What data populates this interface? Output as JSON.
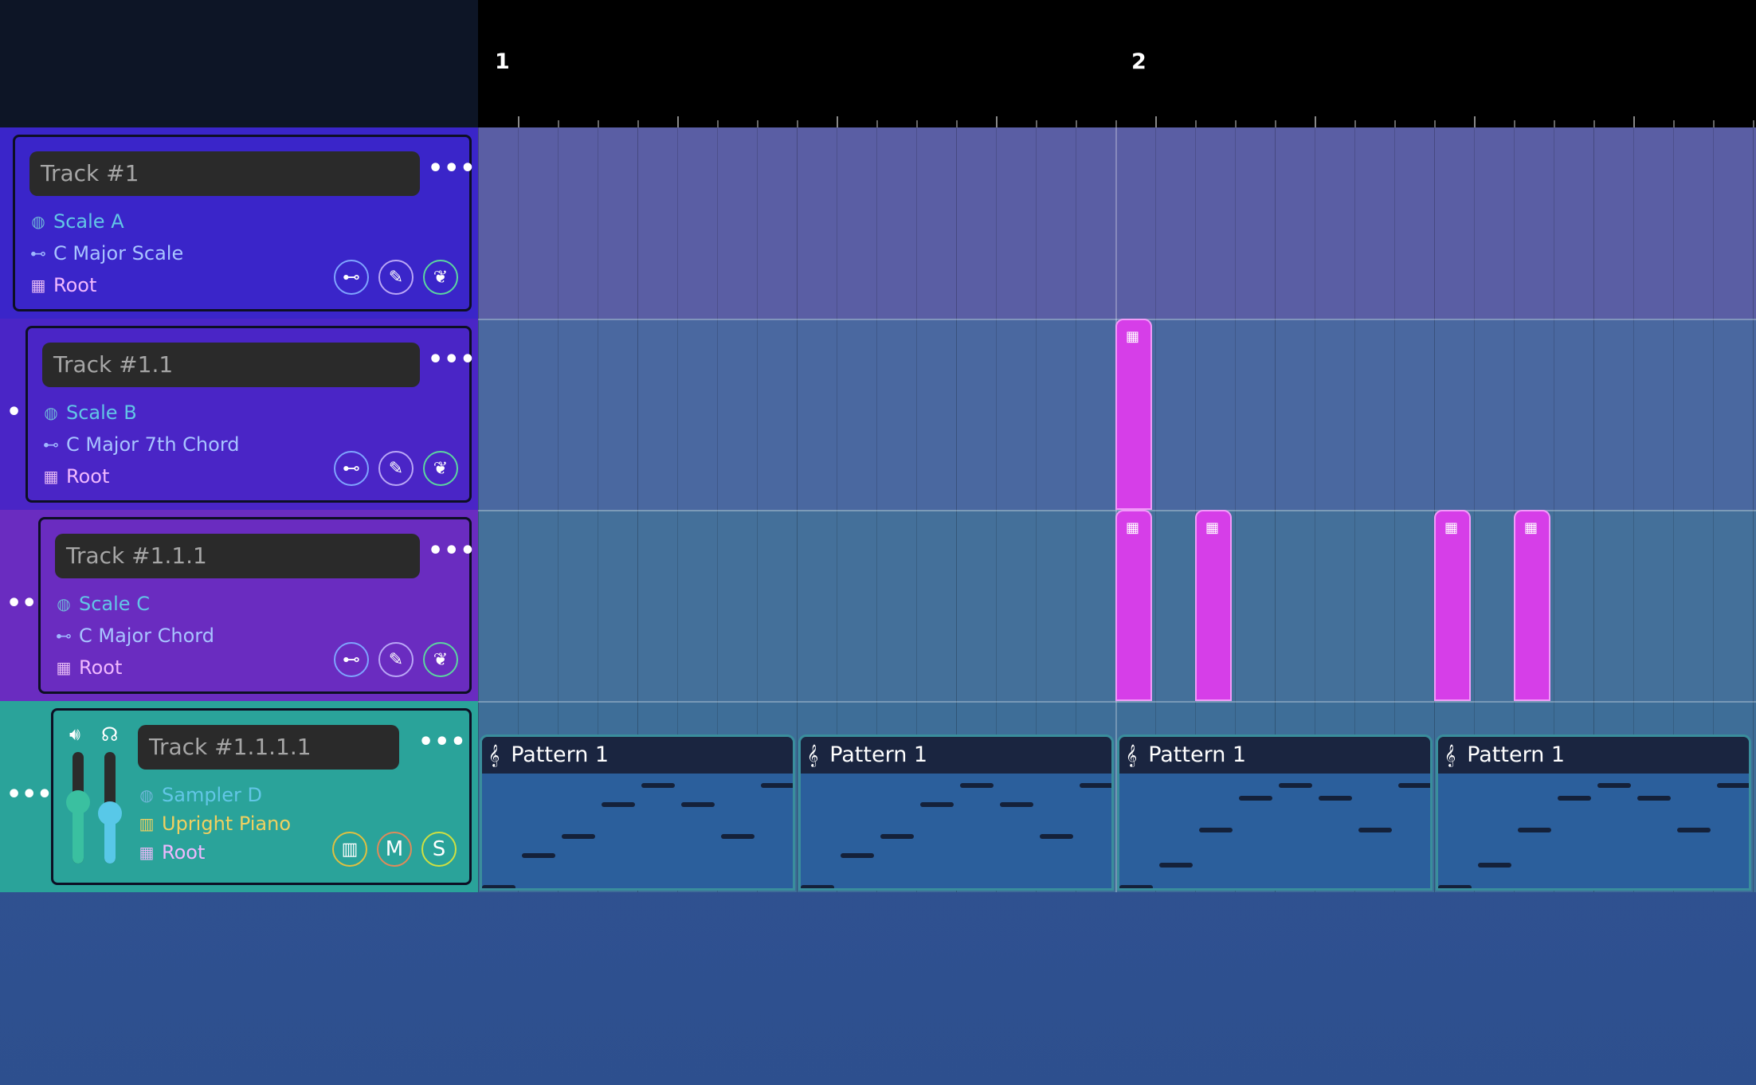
{
  "ruler": {
    "bars": [
      "1",
      "2"
    ]
  },
  "tracks": [
    {
      "name": "Track #1",
      "scale": "Scale A",
      "pattern_type": "C Major Scale",
      "pose": "Root"
    },
    {
      "name": "Track #1.1",
      "scale": "Scale B",
      "pattern_type": "C Major 7th Chord",
      "pose": "Root"
    },
    {
      "name": "Track #1.1.1",
      "scale": "Scale C",
      "pattern_type": "C Major Chord",
      "pose": "Root"
    },
    {
      "name": "Track #1.1.1.1",
      "scale": "Sampler D",
      "instrument": "Upright Piano",
      "pose": "Root",
      "mute_label": "M",
      "solo_label": "S",
      "volume_level": 0.55,
      "pan_level": 0.45
    }
  ],
  "track_menu": "•••",
  "patterns": [
    "Pattern 1",
    "Pattern 1",
    "Pattern 1",
    "Pattern 1"
  ],
  "colors": {
    "clip": "#d63ee8",
    "track1": "#3a25c9",
    "track2": "#4a25c6",
    "track3": "#6a2cc0",
    "track4": "#2aa39a"
  },
  "icons": {
    "scale": "globe-icon",
    "pattern_type": "mask-icon",
    "pose": "calculator-icon",
    "edit": "pencil-icon",
    "leaf": "leaf-icon",
    "keyboard": "piano-icon",
    "volume": "speaker-icon",
    "headphones": "headphones-icon"
  }
}
